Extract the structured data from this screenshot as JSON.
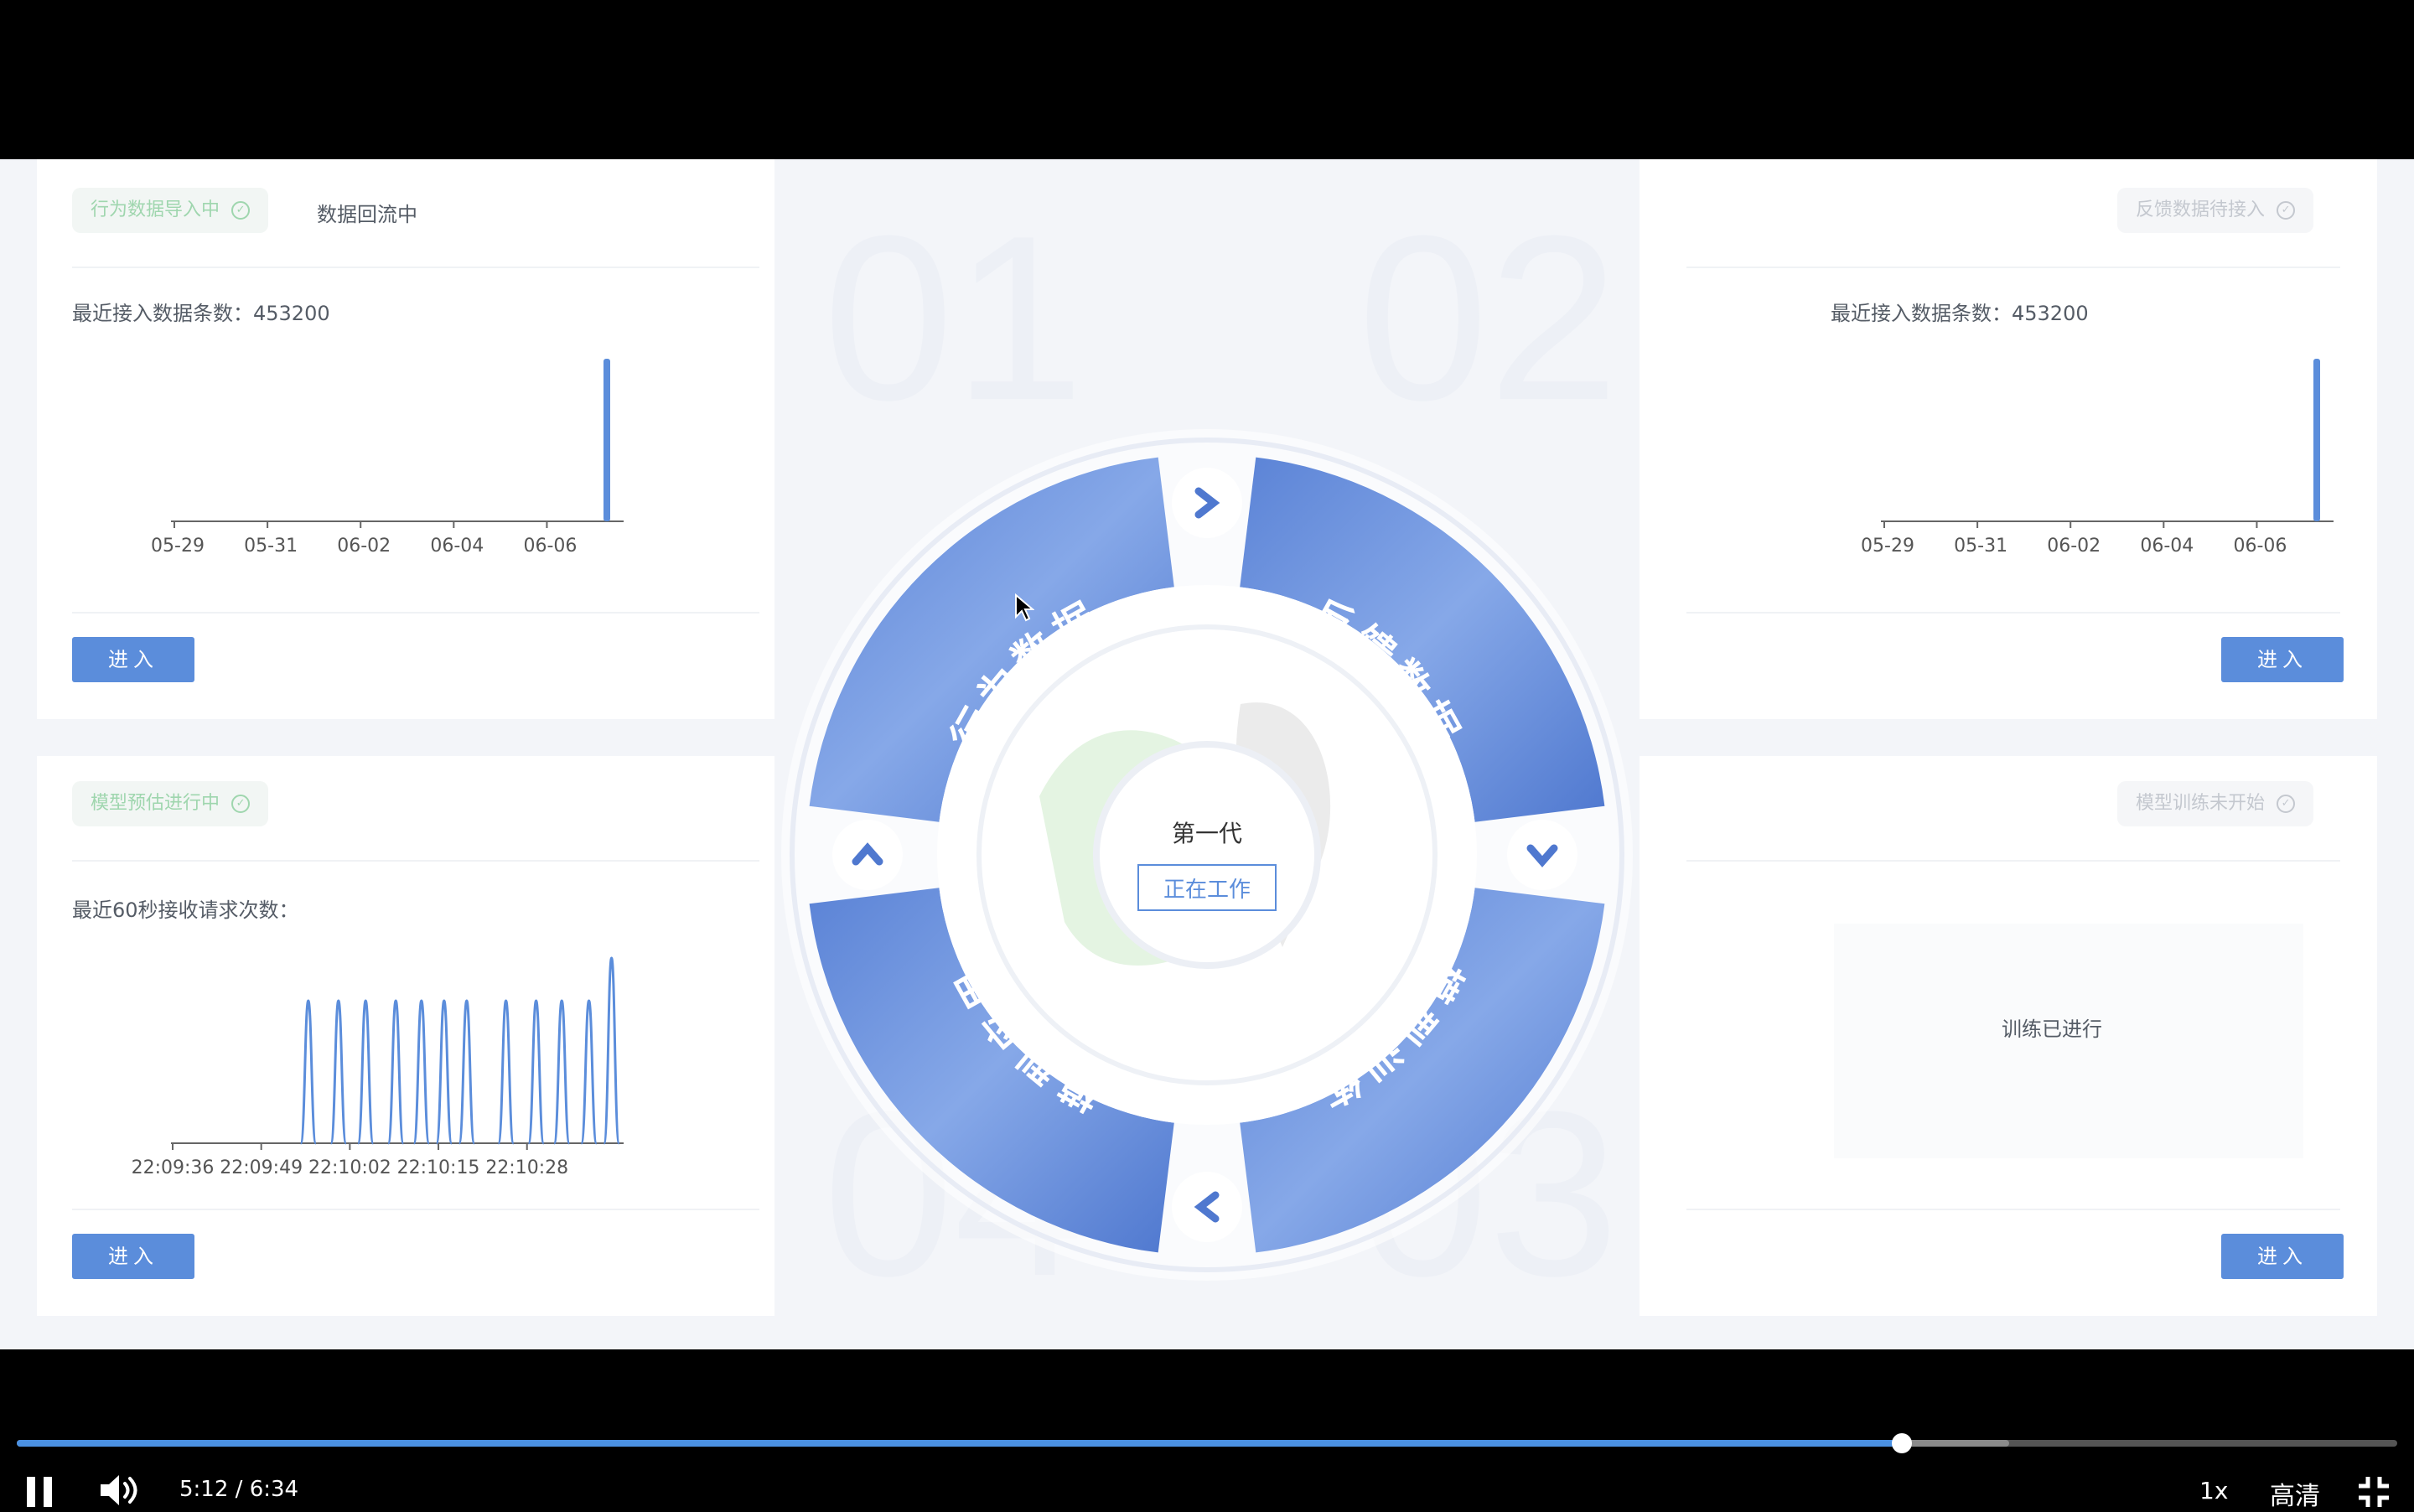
{
  "panels": {
    "top_left": {
      "badge": "行为数据导入中",
      "status_text": "数据回流中",
      "metric_label": "最近接入数据条数：",
      "metric_value": "453200",
      "button": "进入"
    },
    "top_right": {
      "badge": "反馈数据待接入",
      "metric_label": "最近接入数据条数：",
      "metric_value": "453200",
      "button": "进入"
    },
    "bottom_left": {
      "badge": "模型预估进行中",
      "metric_label": "最近60秒接收请求次数：",
      "button": "进入"
    },
    "bottom_right": {
      "badge": "模型训练未开始",
      "center_text": "训练已进行",
      "button": "进入"
    }
  },
  "ghost_numbers": [
    "01",
    "02",
    "03",
    "04"
  ],
  "cycle": {
    "segments": [
      "行为数据",
      "反馈数据",
      "模型训练",
      "模型应用"
    ],
    "generation": "第一代",
    "status": "正在工作"
  },
  "chart_data": [
    {
      "type": "bar",
      "categories": [
        "05-29",
        "05-31",
        "06-02",
        "06-04",
        "06-06"
      ],
      "x": [
        "05-29",
        "05-30",
        "05-31",
        "06-01",
        "06-02",
        "06-03",
        "06-04",
        "06-05",
        "06-06",
        "06-07"
      ],
      "values": [
        0,
        0,
        0,
        0,
        0,
        0,
        0,
        0,
        0,
        453200
      ],
      "ylim": [
        0,
        453200
      ],
      "color": "#5b8ddb"
    },
    {
      "type": "bar",
      "categories": [
        "05-29",
        "05-31",
        "06-02",
        "06-04",
        "06-06"
      ],
      "x": [
        "05-29",
        "05-30",
        "05-31",
        "06-01",
        "06-02",
        "06-03",
        "06-04",
        "06-05",
        "06-06",
        "06-07"
      ],
      "values": [
        0,
        0,
        0,
        0,
        0,
        0,
        0,
        0,
        0,
        453200
      ],
      "ylim": [
        0,
        453200
      ],
      "color": "#5b8ddb"
    },
    {
      "type": "line",
      "categories": [
        "22:09:36",
        "22:09:49",
        "22:10:02",
        "22:10:15",
        "22:10:28"
      ],
      "x_seconds": [
        0,
        60
      ],
      "spikes": [
        {
          "t": 18.2,
          "v": 1
        },
        {
          "t": 22.2,
          "v": 1
        },
        {
          "t": 25.8,
          "v": 1
        },
        {
          "t": 29.8,
          "v": 1
        },
        {
          "t": 33.2,
          "v": 1
        },
        {
          "t": 36.2,
          "v": 1
        },
        {
          "t": 39.2,
          "v": 1
        },
        {
          "t": 44.4,
          "v": 1
        },
        {
          "t": 48.4,
          "v": 1
        },
        {
          "t": 51.8,
          "v": 1
        },
        {
          "t": 55.4,
          "v": 1
        },
        {
          "t": 58.4,
          "v": 1.3
        }
      ],
      "color": "#5b8ddb"
    }
  ],
  "player": {
    "time_current": "5:12",
    "time_separator": "/",
    "time_total": "6:34",
    "speed": "1x",
    "quality": "高清",
    "progress": 0.792,
    "buffered": 0.837,
    "accent": "#4a90e2"
  }
}
